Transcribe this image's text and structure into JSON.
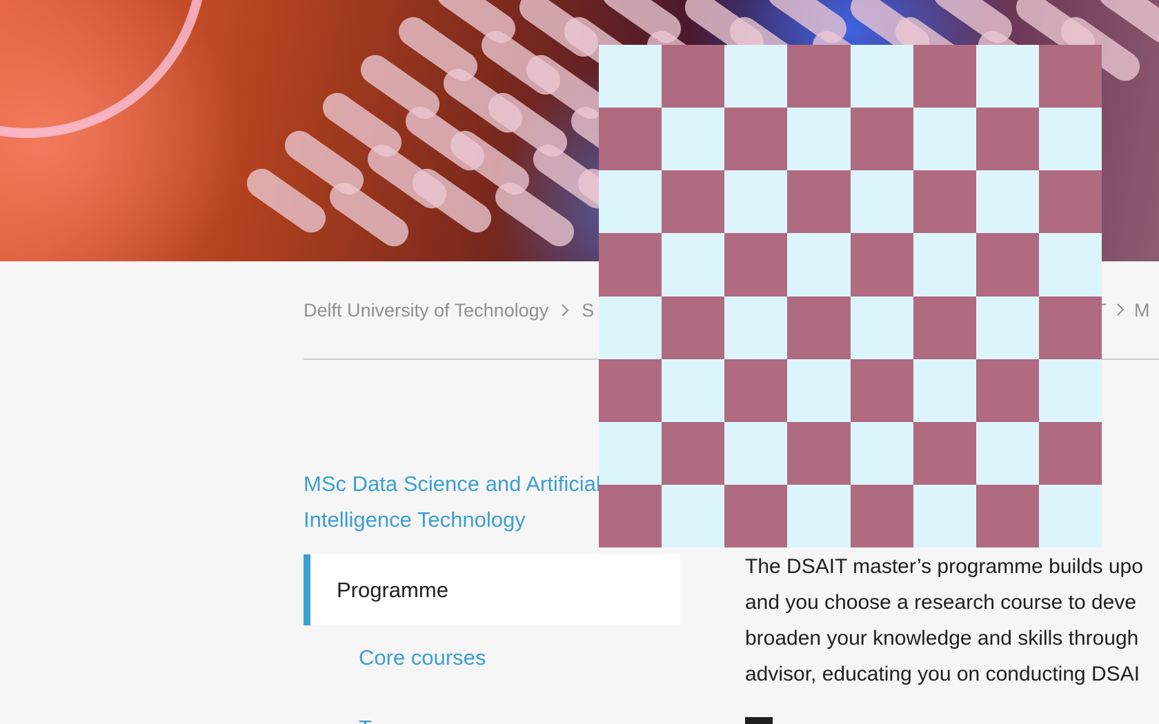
{
  "colors": {
    "accent": "#3a9fd1",
    "page_background": "#f6f6f6",
    "active_item_background": "#ffffff",
    "checker_light": "#dcf4fc",
    "checker_dark": "#b06b80"
  },
  "hero": {
    "image": "hero-banner-image"
  },
  "overlay": {
    "pattern": "checkerboard",
    "rows": 8,
    "columns": 8
  },
  "breadcrumb": {
    "items": [
      "Delft University of Technology",
      "S",
      "AIT",
      "M"
    ],
    "separator_icon": "chevron-right-icon"
  },
  "sidebar": {
    "title": "MSc Data Science and Artificial Intelligence Technology",
    "items": [
      {
        "label": "Programme",
        "active": true
      },
      {
        "label": "Core courses",
        "active": false
      },
      {
        "label": "T",
        "active": false
      }
    ]
  },
  "content": {
    "lines": [
      "The DSAIT master’s programme builds upo",
      "and you choose a research course to deve",
      "broaden your knowledge and skills through",
      "advisor, educating you on conducting DSAI"
    ],
    "next_heading": "P"
  }
}
